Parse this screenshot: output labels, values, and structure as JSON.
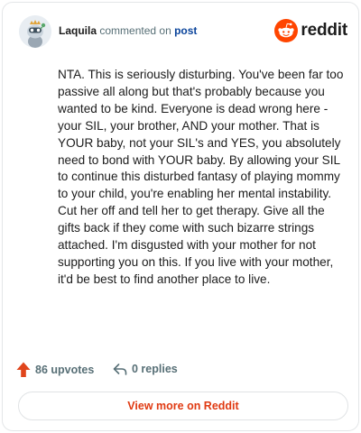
{
  "header": {
    "username": "Laquila",
    "action_text": "commented on",
    "post_link_text": "post",
    "brand": "reddit"
  },
  "comment": {
    "body": "NTA. This is seriously disturbing. You've been far too passive all along but that's probably because you wanted to be kind. Everyone is dead wrong here - your SIL, your brother, AND your mother. That is YOUR baby, not your SIL's and YES, you absolutely need to bond with YOUR baby. By allowing your SIL to continue this disturbed fantasy of playing mommy to your child, you're enabling her mental instability. Cut her off and tell her to get therapy. Give all the gifts back if they come with such bizarre strings attached. I'm disgusted with your mother for not supporting you on this. If you live with your mother, it'd be best to find another place to live."
  },
  "footer": {
    "upvotes": "86 upvotes",
    "replies": "0 replies"
  },
  "cta": {
    "label": "View more on Reddit"
  },
  "colors": {
    "brand_orange": "#ff4500",
    "upvote_orange": "#e0451c",
    "link_blue": "#0a449b",
    "cta_text": "#e03a12",
    "muted_text": "#576f76"
  },
  "icons": {
    "avatar": "snoo-avatar",
    "logo": "reddit-snoo-icon",
    "upvote": "upvote-arrow-icon",
    "reply": "reply-arrow-icon"
  }
}
